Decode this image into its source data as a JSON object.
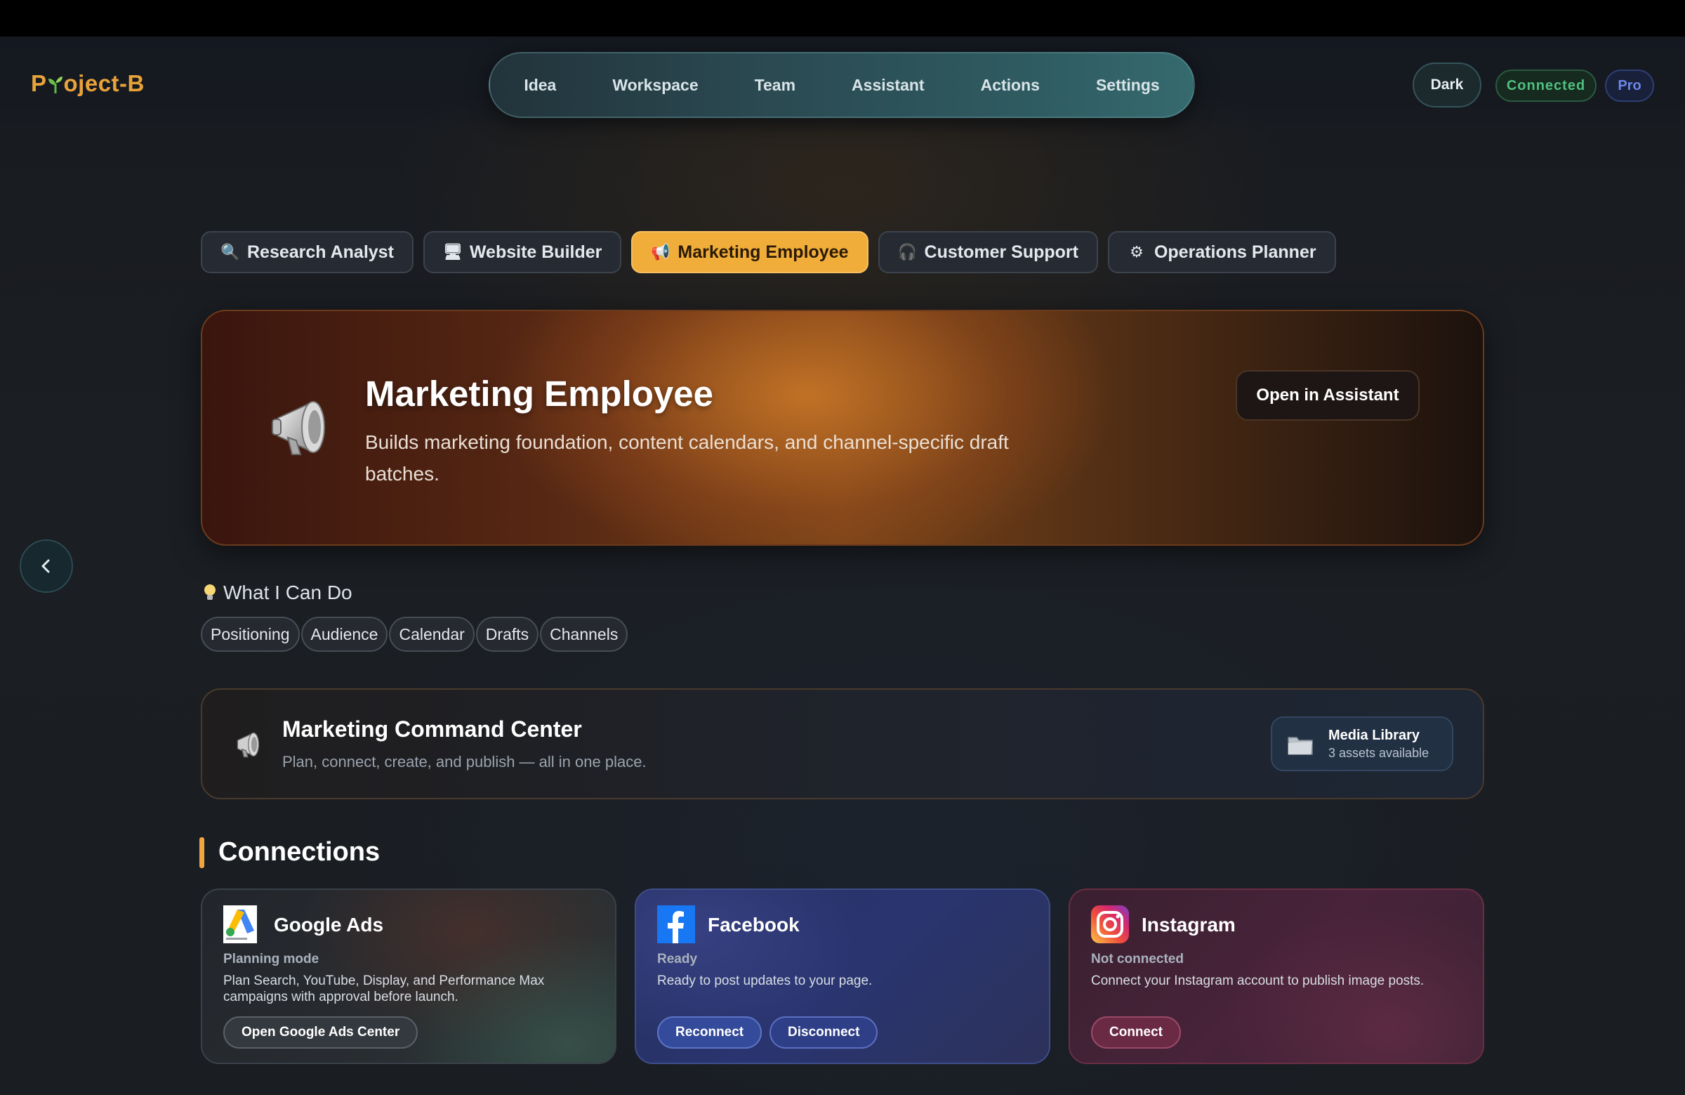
{
  "app": {
    "logo_prefix": "P",
    "logo_suffix": "oject-B"
  },
  "nav": {
    "items": [
      "Idea",
      "Workspace",
      "Team",
      "Assistant",
      "Actions",
      "Settings"
    ]
  },
  "header_right": {
    "theme": "Dark",
    "status": "Connected",
    "plan": "Pro"
  },
  "agent_tabs": [
    {
      "label": "Research Analyst",
      "icon": "🔍"
    },
    {
      "label": "Website Builder",
      "icon": "🖥"
    },
    {
      "label": "Marketing Employee",
      "icon": "📢",
      "active": true
    },
    {
      "label": "Customer Support",
      "icon": "🎧"
    },
    {
      "label": "Operations Planner",
      "icon": "⚙"
    }
  ],
  "hero": {
    "title": "Marketing Employee",
    "description": "Builds marketing foundation, content calendars, and channel-specific draft batches.",
    "button": "Open in Assistant"
  },
  "capabilities": {
    "title": "What I Can Do",
    "chips": [
      "Positioning",
      "Audience",
      "Calendar",
      "Drafts",
      "Channels"
    ]
  },
  "command_center": {
    "title": "Marketing Command Center",
    "subtitle": "Plan, connect, create, and publish — all in one place.",
    "media_title": "Media Library",
    "media_sub": "3 assets available"
  },
  "connections": {
    "title": "Connections",
    "cards": [
      {
        "name": "Google Ads",
        "status": "Planning mode",
        "description": "Plan Search, YouTube, Display, and Performance Max campaigns with approval before launch.",
        "buttons": [
          "Open Google Ads Center"
        ]
      },
      {
        "name": "Facebook",
        "status": "Ready",
        "description": "Ready to post updates to your page.",
        "buttons": [
          "Reconnect",
          "Disconnect"
        ]
      },
      {
        "name": "Instagram",
        "status": "Not connected",
        "description": "Connect your Instagram account to publish image posts.",
        "buttons": [
          "Connect"
        ]
      }
    ]
  },
  "colors": {
    "accent": "#f0ad3a",
    "connected": "#4fc07e",
    "pro": "#6c86e8"
  }
}
